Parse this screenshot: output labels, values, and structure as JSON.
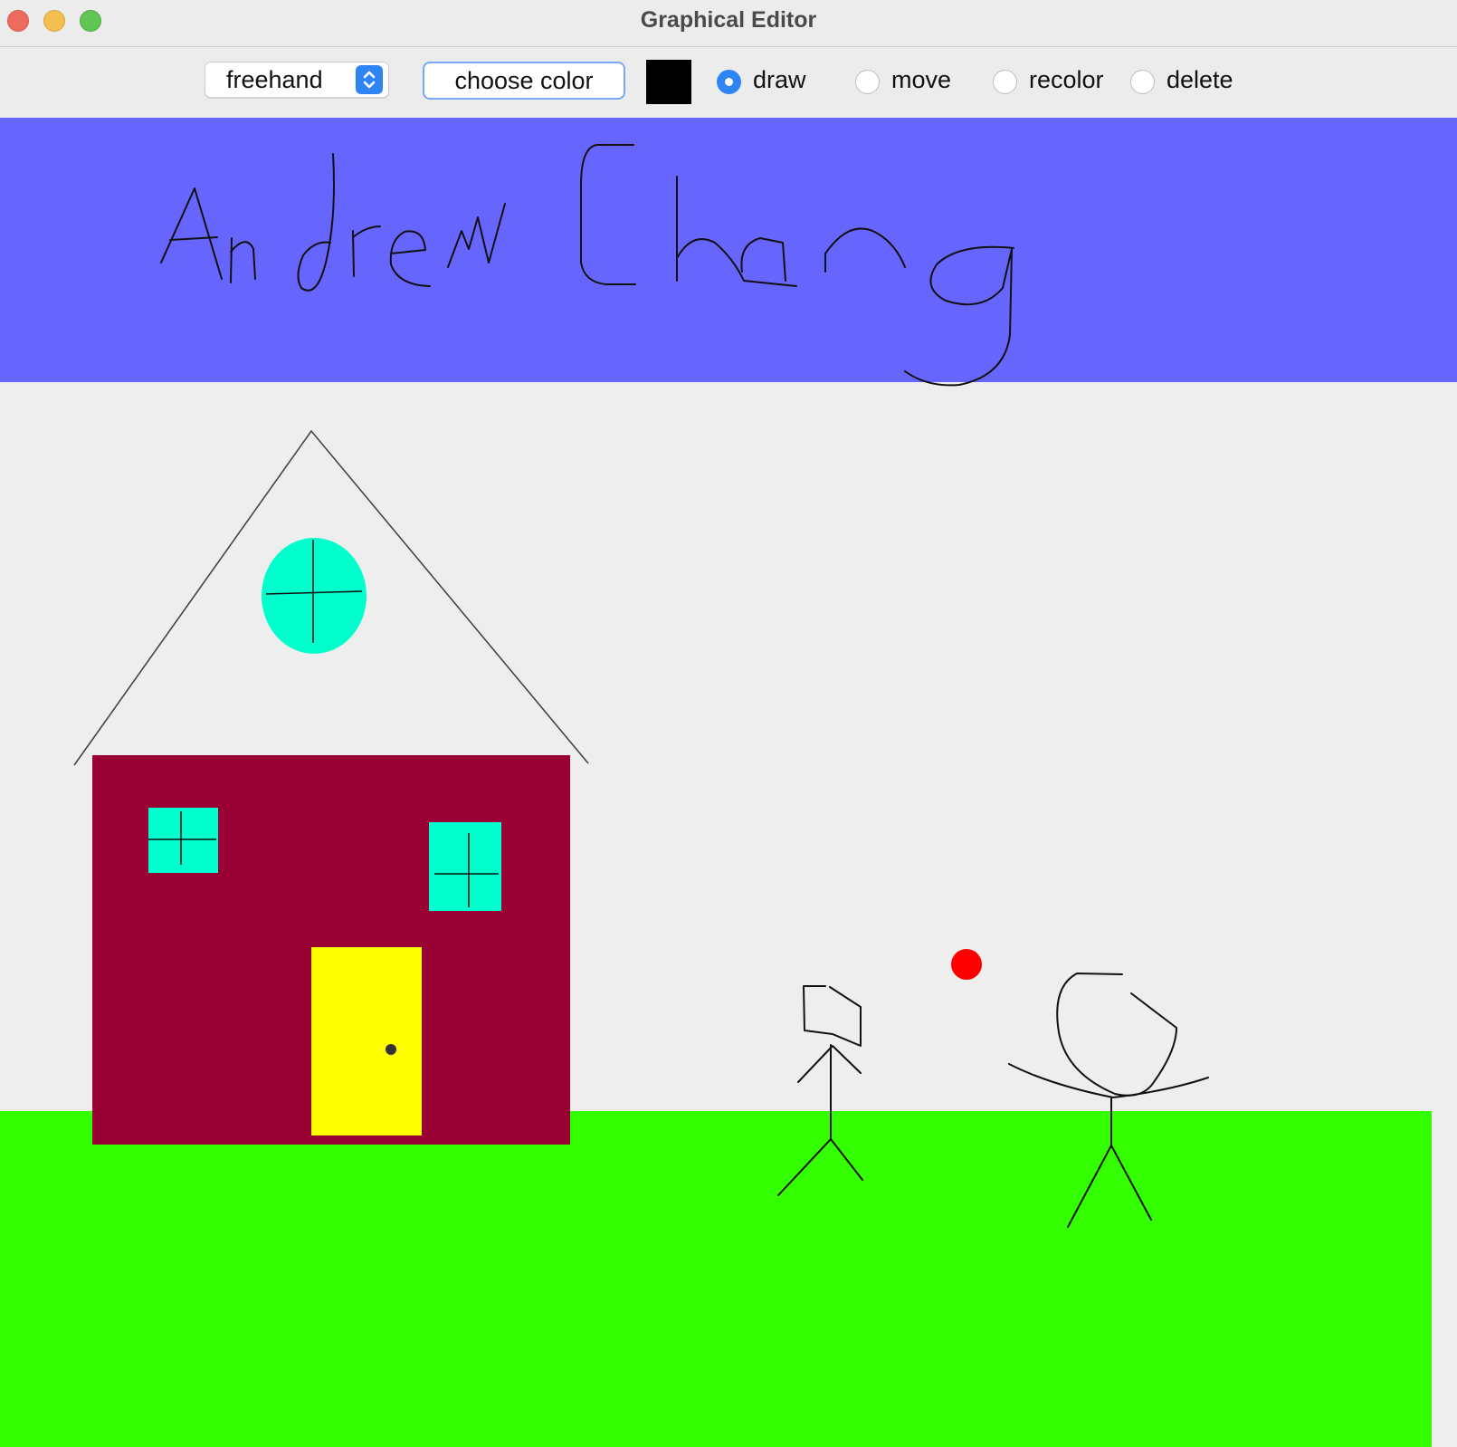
{
  "window": {
    "title": "Graphical Editor"
  },
  "toolbar": {
    "shape_select": {
      "value": "freehand"
    },
    "choose_color_label": "choose color",
    "current_color": "#000000",
    "modes": [
      {
        "label": "draw",
        "selected": true
      },
      {
        "label": "move",
        "selected": false
      },
      {
        "label": "recolor",
        "selected": false
      },
      {
        "label": "delete",
        "selected": false
      }
    ]
  },
  "canvas": {
    "background": "#eeeeee",
    "shapes": [
      {
        "kind": "rectangle",
        "name": "sky-banner",
        "color": "#6666ff"
      },
      {
        "kind": "rectangle",
        "name": "grass",
        "color": "#33ff00"
      },
      {
        "kind": "rectangle",
        "name": "house-body",
        "color": "#990033"
      },
      {
        "kind": "rectangle",
        "name": "house-door",
        "color": "#ffff00"
      },
      {
        "kind": "rectangle",
        "name": "window",
        "color": "#00ffcc"
      },
      {
        "kind": "ellipse",
        "name": "round-window",
        "color": "#00ffcc"
      },
      {
        "kind": "ellipse",
        "name": "red-ball",
        "color": "#ff0000"
      },
      {
        "kind": "freehand",
        "name": "signature",
        "color": "#000000",
        "text": "Andrew Chang"
      },
      {
        "kind": "freehand",
        "name": "stick-figure",
        "color": "#000000"
      },
      {
        "kind": "segment",
        "name": "roof",
        "color": "#444444"
      }
    ]
  }
}
